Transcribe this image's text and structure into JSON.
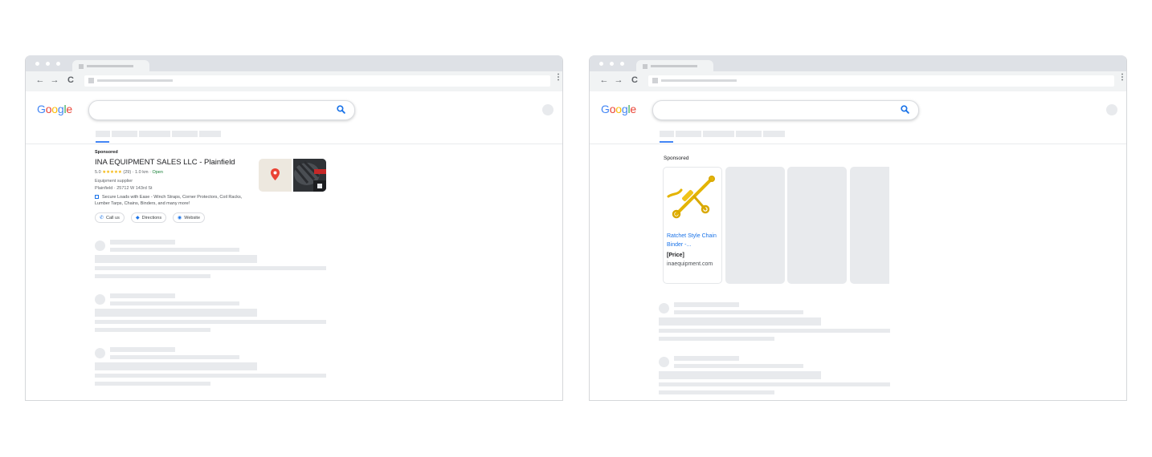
{
  "left_window": {
    "google_logo": "Google",
    "sponsored_label": "Sponsored",
    "listing": {
      "title": "INA EQUIPMENT SALES LLC - Plainfield",
      "rating": "5.0",
      "stars": "★★★★★",
      "review_count": "(29)",
      "distance": "· 1.0 km ·",
      "open_status": "Open",
      "category": "Equipment supplier",
      "address": "Plainfield · 25712 W 143rd St",
      "promo": "Secure Loads with Ease - Winch Straps, Corner Protectors, Coil Racks, Lumber Tarps, Chains, Binders, and many more!"
    },
    "buttons": {
      "call": "Call us",
      "directions": "Directions",
      "website": "Website"
    }
  },
  "right_window": {
    "google_logo": "Google",
    "sponsored_label": "Sponsored",
    "product": {
      "name": "Ratchet Style Chain Binder -...",
      "price": "[Price]",
      "store": "inaequipment.com"
    }
  },
  "icons": {
    "back": "←",
    "forward": "→",
    "reload": "C",
    "star": "☆",
    "menu": "⋮",
    "call": "✆",
    "directions": "◆",
    "website": "◉"
  },
  "colors": {
    "accent": "#1a73e8",
    "google_blue": "#4285f4",
    "google_red": "#ea4335",
    "google_yellow": "#fbbc05",
    "google_green": "#34a853",
    "star_color": "#f4b400",
    "open_color": "#188038",
    "skeleton": "#e8eaed"
  }
}
